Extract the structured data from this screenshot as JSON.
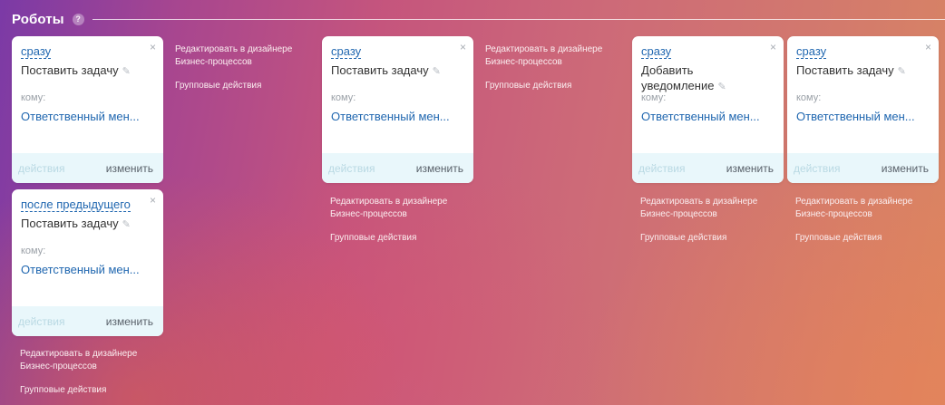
{
  "header": {
    "title": "Роботы",
    "help_icon": "question-circle-icon",
    "help_symbol": "?"
  },
  "card_common": {
    "close_symbol": "×",
    "recipient_label": "кому:",
    "actions_label": "действия",
    "edit_label": "изменить",
    "pencil_symbol": "✎"
  },
  "links": {
    "designer": "Редактировать в дизайнере Бизнес-процессов",
    "group": "Групповые действия"
  },
  "cards": [
    {
      "trigger": "сразу",
      "title": "Поставить задачу",
      "recipient": "Ответственный мен..."
    },
    {
      "trigger": "после предыдущего",
      "title": "Поставить задачу",
      "recipient": "Ответственный мен..."
    },
    {
      "trigger": "сразу",
      "title": "Поставить задачу",
      "recipient": "Ответственный мен..."
    },
    {
      "trigger": "сразу",
      "title": "Добавить уведомление",
      "recipient": "Ответственный мен..."
    },
    {
      "trigger": "сразу",
      "title": "Поставить задачу",
      "recipient": "Ответственный мен..."
    }
  ]
}
